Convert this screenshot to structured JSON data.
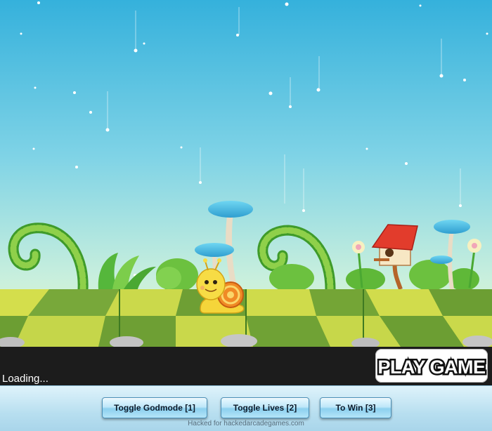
{
  "game": {
    "status_text": "Loading...",
    "play_button_label": "PLAY GAME"
  },
  "hack_menu": {
    "buttons": [
      {
        "label": "Toggle Godmode [1]"
      },
      {
        "label": "Toggle Lives [2]"
      },
      {
        "label": "To Win [3]"
      }
    ],
    "credit": "Hacked for hackedarcadegames.com"
  },
  "colors": {
    "sky_top": "#37b3dc",
    "sky_bottom": "#d9f6c8",
    "grass_light": "#c9d94a",
    "grass_dark": "#5f9a2e",
    "loading_bar": "#1c1c1c",
    "button_blue": "#8cd0ef"
  }
}
